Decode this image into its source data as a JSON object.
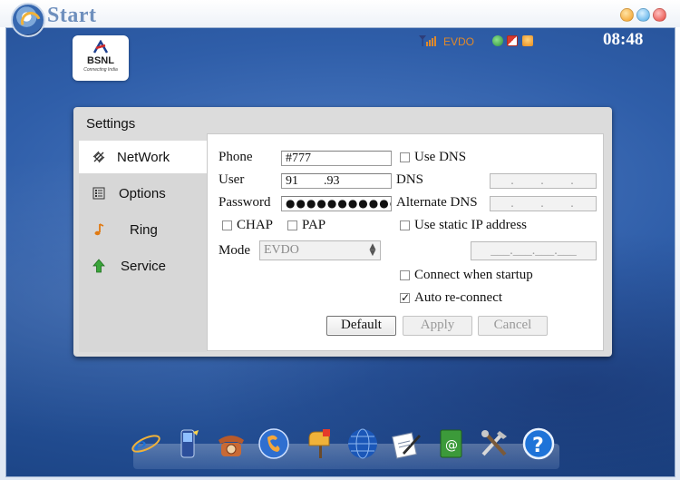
{
  "app": {
    "title": "Start"
  },
  "brand": {
    "name": "BSNL",
    "tagline": "Connecting India"
  },
  "status": {
    "network": "EVDO",
    "clock": "08:48"
  },
  "dialog": {
    "title": "Settings",
    "nav": [
      {
        "label": "NetWork",
        "icon": "satellite-icon",
        "active": true
      },
      {
        "label": "Options",
        "icon": "list-icon",
        "active": false
      },
      {
        "label": "Ring",
        "icon": "music-note-icon",
        "active": false
      },
      {
        "label": "Service",
        "icon": "up-arrow-icon",
        "active": false
      }
    ],
    "form": {
      "phone_label": "Phone",
      "phone_value": "#777",
      "user_label": "User",
      "user_value": "91        .93",
      "password_label": "Password",
      "password_value": "●●●●●●●●●●●",
      "mode_label": "Mode",
      "mode_value": "EVDO",
      "chap_label": "CHAP",
      "pap_label": "PAP",
      "use_dns_label": "Use DNS",
      "dns_label": "DNS",
      "dns_value": ".     .     .",
      "alt_dns_label": "Alternate DNS",
      "alt_dns_value": ".     .     .",
      "static_ip_label": "Use static IP address",
      "static_ip_value": "___.___.___.___",
      "connect_startup_label": "Connect when startup",
      "auto_reconnect_label": "Auto re-connect",
      "checks": {
        "chap": false,
        "pap": false,
        "use_dns": false,
        "static_ip": false,
        "connect_startup": false,
        "auto_reconnect": true
      }
    },
    "buttons": {
      "default": "Default",
      "apply": "Apply",
      "cancel": "Cancel"
    }
  },
  "dock": [
    "internet-explorer-icon",
    "mobile-phone-icon",
    "telephone-icon",
    "contacts-icon",
    "mailbox-icon",
    "globe-icon",
    "notepad-icon",
    "address-book-icon",
    "tools-icon",
    "help-icon"
  ],
  "check_mark": "✓",
  "select_arrow": "▲▼"
}
